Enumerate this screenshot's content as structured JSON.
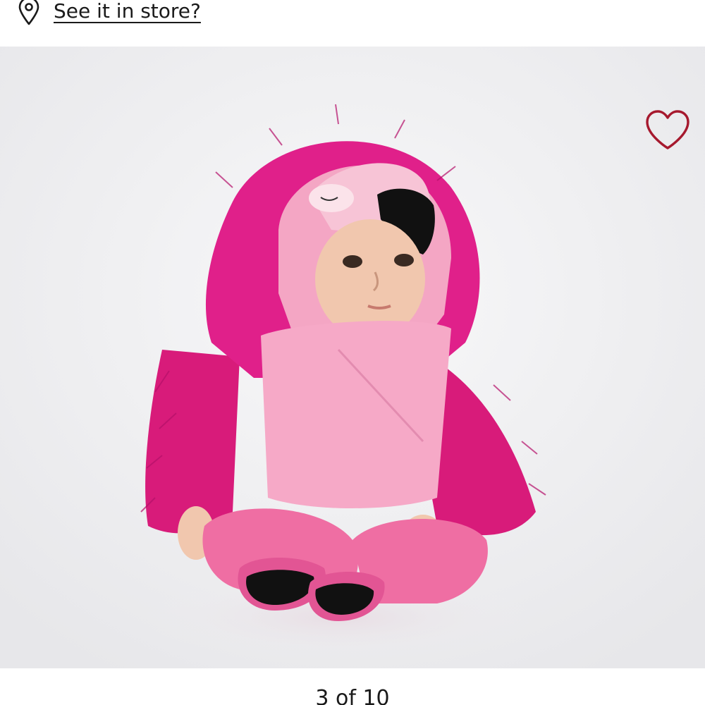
{
  "store": {
    "icon": "location-pin-icon",
    "label": "See it in store?"
  },
  "gallery": {
    "image": "baby-flamingo-costume-photo",
    "wishlist_icon": "heart-outline-icon",
    "wishlist_color": "#a6192e",
    "position_text": "3 of 10"
  }
}
